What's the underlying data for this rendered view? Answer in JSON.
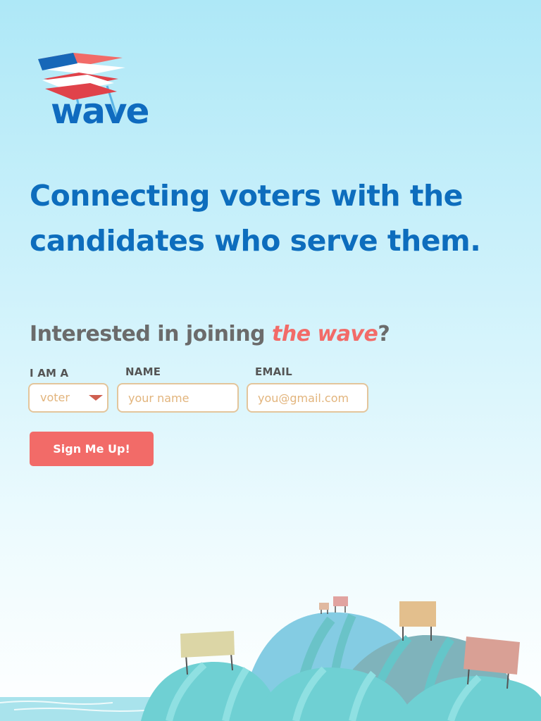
{
  "brand": {
    "name": "wave",
    "icon": "flag-icon"
  },
  "hero": {
    "headline": "Connecting voters with the candidates who serve them."
  },
  "signup": {
    "prompt_prefix": "Interested in joining ",
    "prompt_accent": "the wave",
    "prompt_suffix": "?",
    "role_label": "I AM A",
    "role_value": "voter",
    "name_label": "NAME",
    "name_placeholder": "your name",
    "email_label": "EMAIL",
    "email_placeholder": "you@gmail.com",
    "submit_label": "Sign Me Up!"
  },
  "colors": {
    "brand_blue": "#0d6dbd",
    "accent_coral": "#f26b68",
    "field_border": "#e3c59b",
    "placeholder": "#e2b47c"
  }
}
